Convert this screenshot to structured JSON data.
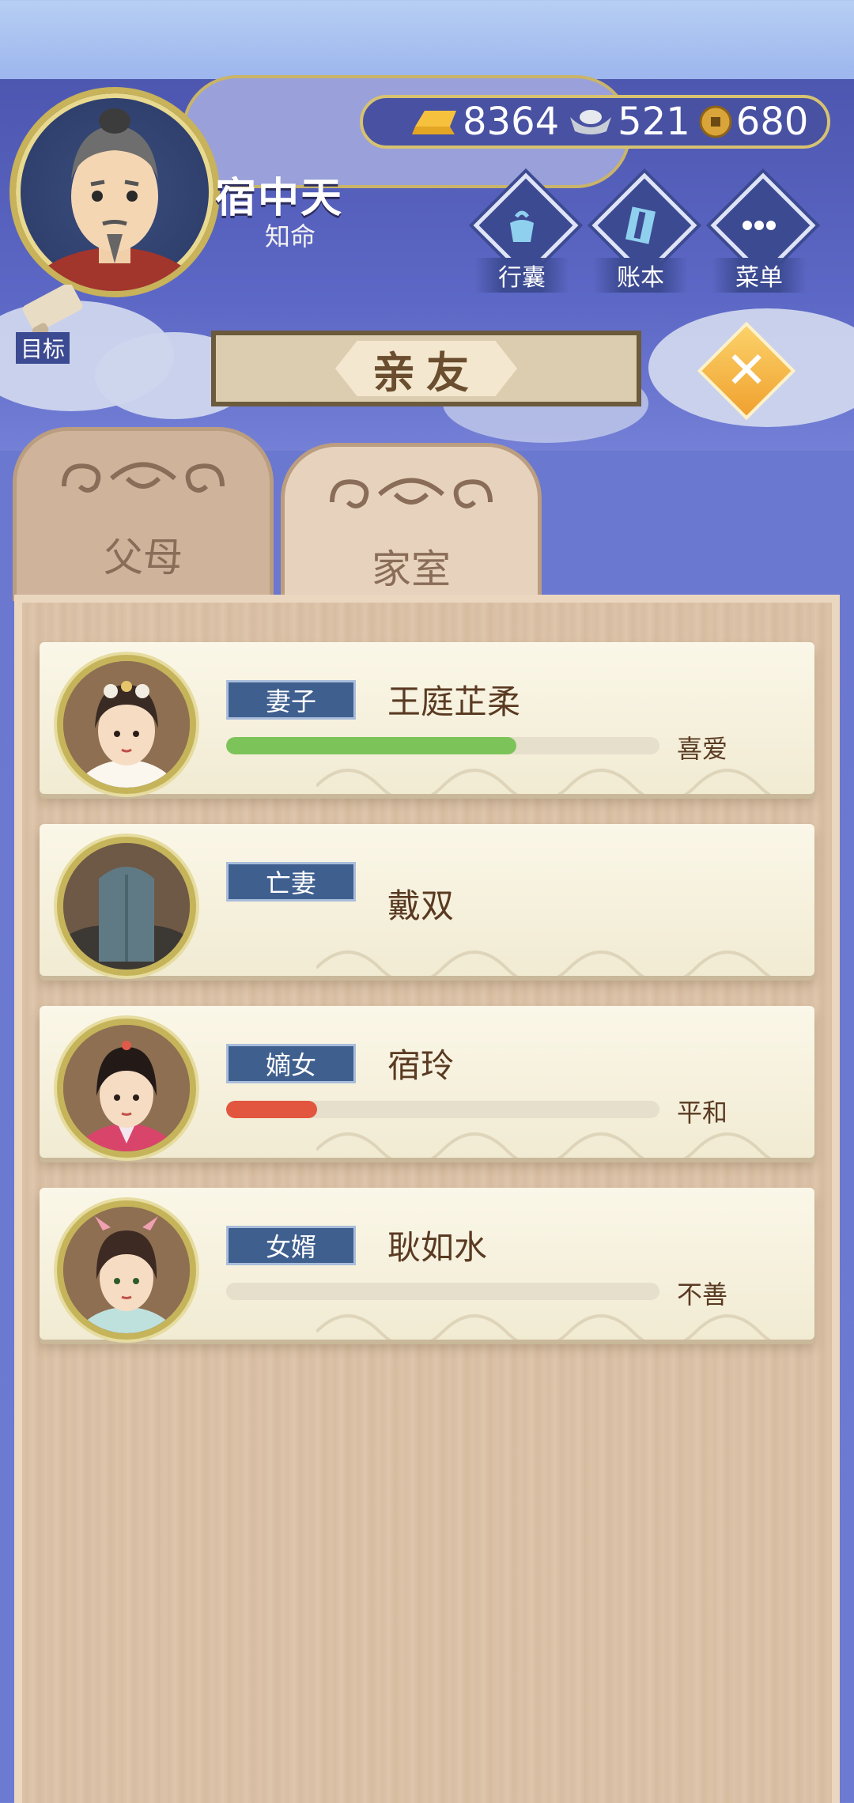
{
  "player": {
    "name": "宿中天",
    "title": "知命"
  },
  "currency": {
    "gold": "8364",
    "silver": "521",
    "coins": "680"
  },
  "menu": {
    "bag_label": "行囊",
    "ledger_label": "账本",
    "menu_label": "菜单",
    "goal_label": "目标"
  },
  "panel": {
    "title": "亲友"
  },
  "tabs": {
    "parents_label": "父母",
    "family_label": "家室",
    "active": "家室"
  },
  "relatives": [
    {
      "relation": "妻子",
      "name": "王庭芷柔",
      "attitude": "喜爱",
      "affection": 0.67,
      "bar_color": "#7cc45a"
    },
    {
      "relation": "亡妻",
      "name": "戴双"
    },
    {
      "relation": "嫡女",
      "name": "宿玲",
      "attitude": "平和",
      "affection": 0.21,
      "bar_color": "#e2563f"
    },
    {
      "relation": "女婿",
      "name": "耿如水",
      "attitude": "不善",
      "affection": 0.0,
      "bar_color": "#e2563f"
    }
  ]
}
